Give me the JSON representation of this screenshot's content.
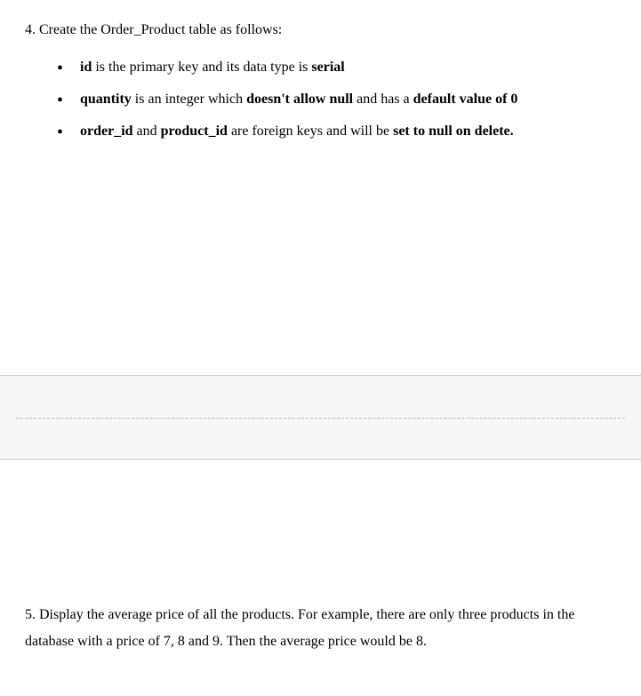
{
  "q4": {
    "intro": "4. Create the Order_Product table as follows:",
    "bullets": [
      {
        "b1": "id",
        "t1": " is the primary key and its data type is ",
        "b2": "serial"
      },
      {
        "b1": "quantity",
        "t1": " is an integer which ",
        "b2": "doesn't allow null",
        "t2": " and has a ",
        "b3": "default value of 0"
      },
      {
        "b1": "order_id",
        "t1": " and ",
        "b2": "product_id",
        "t2": " are foreign keys and will be ",
        "b3": "set to null on delete."
      }
    ]
  },
  "q5": {
    "text": "5. Display the average price of all the products. For example, there are only three products in the database with a price of 7, 8 and 9. Then the average price would be 8."
  }
}
